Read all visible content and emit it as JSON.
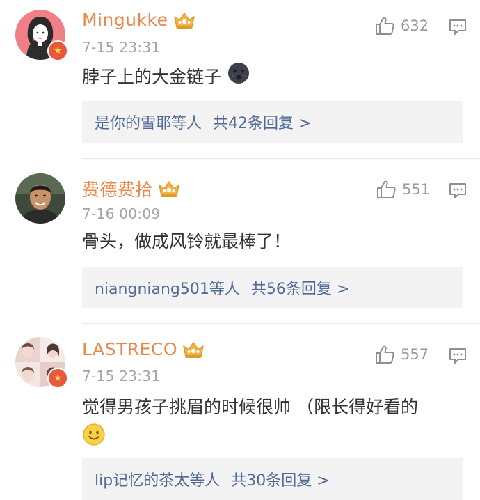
{
  "comments": [
    {
      "username": "Mingukke",
      "timestamp": "7-15 23:31",
      "text": "脖子上的大金链子",
      "emoji": "dark-face-emoji",
      "likes": "632",
      "reply_users": "是你的雪耶等人",
      "reply_count": "共42条回复 >",
      "avatar": "illustrated-woman-avatar",
      "verified": true
    },
    {
      "username": "费德费拾",
      "timestamp": "7-16 00:09",
      "text": "骨头，做成风铃就最棒了！",
      "likes": "551",
      "reply_users": "niangniang501等人",
      "reply_count": "共56条回复 >",
      "avatar": "man-photo-avatar",
      "verified": false
    },
    {
      "username": "LASTRECO",
      "timestamp": "7-15 23:31",
      "text": "觉得男孩子挑眉的时候很帅 （限长得好看的",
      "emoji": "smile-emoji",
      "likes": "557",
      "reply_users": "lip记忆的茶太等人",
      "reply_count": "共30条回复 >",
      "avatar": "collage-photo-avatar",
      "verified": true
    }
  ],
  "colors": {
    "username": "#e8884a",
    "reply_link": "#506b96",
    "meta_gray": "#a5a5a5",
    "badge_red": "#e8583a",
    "crown_gold": "#f2b544"
  }
}
